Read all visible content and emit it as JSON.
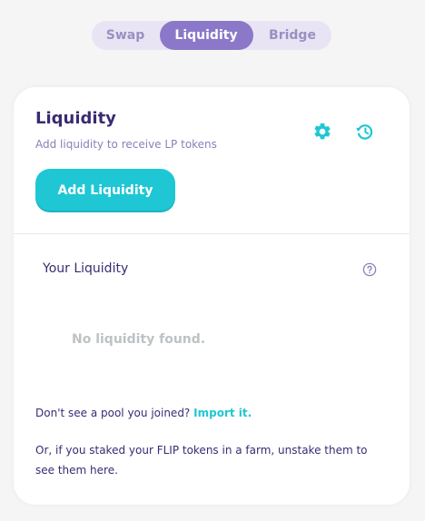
{
  "tabs": {
    "swap": "Swap",
    "liquidity": "Liquidity",
    "bridge": "Bridge"
  },
  "card": {
    "title": "Liquidity",
    "subtitle": "Add liquidity to receive LP tokens",
    "add_button": "Add Liquidity",
    "your_liquidity": "Your Liquidity",
    "empty_message": "No liquidity found.",
    "pool_question": "Don't see a pool you joined?",
    "import_link": "Import it.",
    "unstake_note": "Or, if you staked your FLIP tokens in a farm, unstake them to see them here."
  },
  "icons": {
    "settings": "gear-icon",
    "history": "history-icon",
    "help": "question-circle-icon"
  },
  "colors": {
    "accent": "#1fc7d4",
    "tab_active": "#8c78c8",
    "tab_bg": "#e9e4f4",
    "text_primary": "#3a2b73",
    "text_secondary": "#8d7fb8"
  }
}
